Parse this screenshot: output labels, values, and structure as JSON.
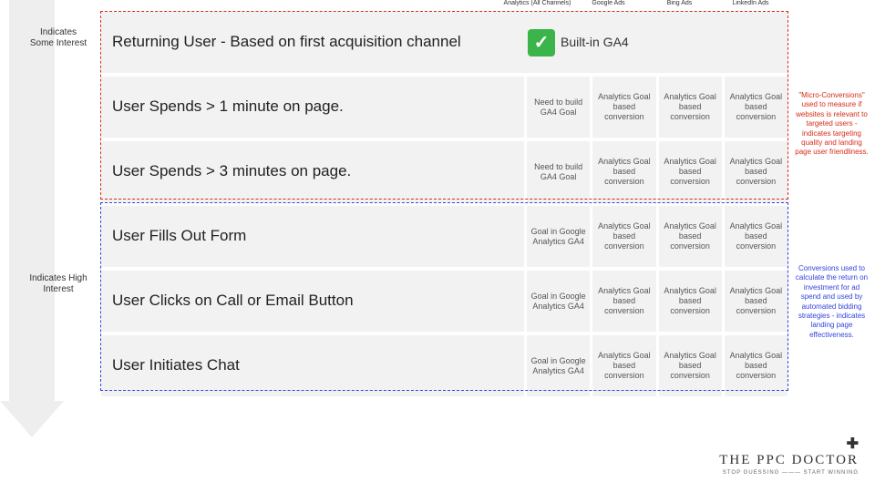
{
  "arrow": {
    "label_some": "Indicates Some Interest",
    "label_high": "Indicates High Interest"
  },
  "headers": {
    "c1": "Analytics (All Channels)",
    "c2": "Google Ads",
    "c3": "Bing Ads",
    "c4": "LinkedIn Ads"
  },
  "rows": {
    "r0": {
      "action": "Returning User - Based on first acquisition channel",
      "builtin": "Built-in GA4"
    },
    "r1": {
      "action": "User Spends > 1 minute on page.",
      "c1": "Need to build GA4 Goal",
      "c2": "Analytics Goal based conversion",
      "c3": "Analytics Goal based conversion",
      "c4": "Analytics Goal based conversion"
    },
    "r2": {
      "action": "User Spends > 3 minutes on page.",
      "c1": "Need to build GA4 Goal",
      "c2": "Analytics Goal based conversion",
      "c3": "Analytics Goal based conversion",
      "c4": "Analytics Goal based conversion"
    },
    "r3": {
      "action": "User Fills Out Form",
      "c1": "Goal in Google Analytics GA4",
      "c2": "Analytics Goal based conversion",
      "c3": "Analytics Goal based conversion",
      "c4": "Analytics Goal based conversion"
    },
    "r4": {
      "action": "User Clicks on Call or Email Button",
      "c1": "Goal in Google Analytics GA4",
      "c2": "Analytics Goal based conversion",
      "c3": "Analytics Goal based conversion",
      "c4": "Analytics Goal based conversion"
    },
    "r5": {
      "action": "User Initiates Chat",
      "c1": "Goal in Google Analytics GA4",
      "c2": "Analytics Goal based conversion",
      "c3": "Analytics Goal based conversion",
      "c4": "Analytics Goal based conversion"
    }
  },
  "notes": {
    "red": "\"Micro-Conversions\" used to measure if websites is relevant to targeted users - indicates targeting quality and landing page user friendliness.",
    "blue": "Conversions used to calculate the return on investment for ad spend and used by automated bidding strategies - indicates landing page effectiveness."
  },
  "logo": {
    "brand": "THE PPC DOCTOR",
    "tag": "STOP GUESSING ——— START WINNING"
  }
}
